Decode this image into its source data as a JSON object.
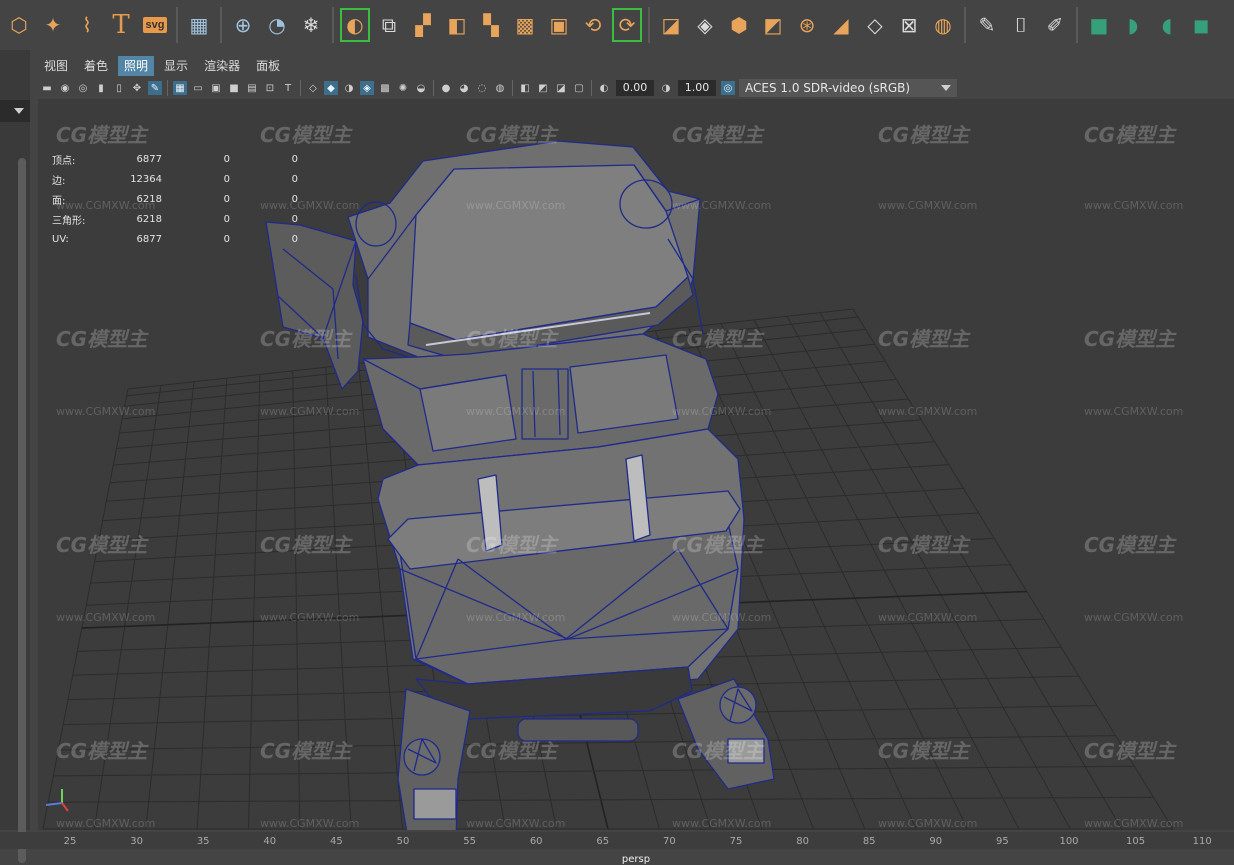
{
  "shelf": {
    "icons": [
      {
        "name": "polygon-sphere-icon",
        "glyph": "⬡",
        "tone": ""
      },
      {
        "name": "superellipse-icon",
        "glyph": "✦",
        "tone": ""
      },
      {
        "name": "sweep-mesh-icon",
        "glyph": "⌇",
        "tone": ""
      },
      {
        "name": "type-text-icon",
        "glyph": "T",
        "tone": "text"
      },
      {
        "name": "svg-icon",
        "glyph": "svg",
        "tone": "svg"
      },
      {
        "name": "sep",
        "glyph": "",
        "tone": "sep"
      },
      {
        "name": "uv-grid-icon",
        "glyph": "▦",
        "tone": "blue"
      },
      {
        "name": "sep",
        "glyph": "",
        "tone": "sep"
      },
      {
        "name": "pivot-icon",
        "glyph": "⊕",
        "tone": "blue"
      },
      {
        "name": "clear-pivot-icon",
        "glyph": "◔",
        "tone": "blue"
      },
      {
        "name": "freeze-transform-icon",
        "glyph": "❄",
        "tone": "white"
      },
      {
        "name": "sep",
        "glyph": "",
        "tone": "sep"
      },
      {
        "name": "smooth-mesh-icon",
        "glyph": "◐",
        "tone": "boxed"
      },
      {
        "name": "layer-combine-icon",
        "glyph": "⧉",
        "tone": "white"
      },
      {
        "name": "extract-icon",
        "glyph": "▞",
        "tone": ""
      },
      {
        "name": "separate-icon",
        "glyph": "◧",
        "tone": ""
      },
      {
        "name": "mirror-icon",
        "glyph": "▚",
        "tone": ""
      },
      {
        "name": "smooth-icon",
        "glyph": "▩",
        "tone": ""
      },
      {
        "name": "reduce-icon",
        "glyph": "▣",
        "tone": ""
      },
      {
        "name": "remesh-icon",
        "glyph": "⟲",
        "tone": ""
      },
      {
        "name": "retopo-icon",
        "glyph": "⟳",
        "tone": "boxed"
      },
      {
        "name": "sep",
        "glyph": "",
        "tone": "sep"
      },
      {
        "name": "extrude-icon",
        "glyph": "◪",
        "tone": ""
      },
      {
        "name": "bevel-icon",
        "glyph": "◈",
        "tone": "white"
      },
      {
        "name": "bridge-icon",
        "glyph": "⬢",
        "tone": ""
      },
      {
        "name": "merge-icon",
        "glyph": "◩",
        "tone": ""
      },
      {
        "name": "target-weld-icon",
        "glyph": "⊛",
        "tone": ""
      },
      {
        "name": "poke-icon",
        "glyph": "◢",
        "tone": ""
      },
      {
        "name": "wedge-icon",
        "glyph": "◇",
        "tone": "white"
      },
      {
        "name": "circularize-icon",
        "glyph": "⊠",
        "tone": "white"
      },
      {
        "name": "sculpt-sphere-icon",
        "glyph": "◍",
        "tone": ""
      },
      {
        "name": "sep",
        "glyph": "",
        "tone": "sep"
      },
      {
        "name": "multi-cut-icon",
        "glyph": "✎",
        "tone": "white"
      },
      {
        "name": "insert-edge-loop-icon",
        "glyph": "⌷",
        "tone": "white"
      },
      {
        "name": "connect-icon",
        "glyph": "✐",
        "tone": "white"
      },
      {
        "name": "sep",
        "glyph": "",
        "tone": "sep"
      },
      {
        "name": "uv-editor-icon",
        "glyph": "■",
        "tone": "teal"
      },
      {
        "name": "uv-unfold-icon",
        "glyph": "◗",
        "tone": "teal"
      },
      {
        "name": "uv-layout-icon",
        "glyph": "◖",
        "tone": "teal"
      },
      {
        "name": "uv-cut-icon",
        "glyph": "◼",
        "tone": "teal"
      }
    ]
  },
  "menu": {
    "items": [
      "视图",
      "着色",
      "照明",
      "显示",
      "渲染器",
      "面板"
    ],
    "active_index": 2
  },
  "view_toolbar": {
    "exposure_value": "0.00",
    "gamma_value": "1.00",
    "color_space": "ACES 1.0 SDR-video (sRGB)"
  },
  "hud": {
    "rows": [
      {
        "label": "顶点:",
        "a": "6877",
        "b": "0",
        "c": "0"
      },
      {
        "label": "边:",
        "a": "12364",
        "b": "0",
        "c": "0"
      },
      {
        "label": "面:",
        "a": "6218",
        "b": "0",
        "c": "0"
      },
      {
        "label": "三角形:",
        "a": "6218",
        "b": "0",
        "c": "0"
      },
      {
        "label": "UV:",
        "a": "6877",
        "b": "0",
        "c": "0"
      }
    ]
  },
  "camera_label": "persp",
  "watermarks": {
    "logo_text": "CG模型主",
    "url_text": "www.CGMXW.com"
  },
  "timeline": {
    "ticks": [
      "25",
      "30",
      "35",
      "40",
      "45",
      "50",
      "55",
      "60",
      "65",
      "70",
      "75",
      "80",
      "85",
      "90",
      "95",
      "100",
      "105",
      "110"
    ]
  },
  "colors": {
    "accent_blue": "#5285a6",
    "shelf_orange": "#e89a4a",
    "wire_blue": "#1e2580",
    "mesh_gray": "#6f6f6f",
    "grid_line": "#2c2c2c"
  }
}
